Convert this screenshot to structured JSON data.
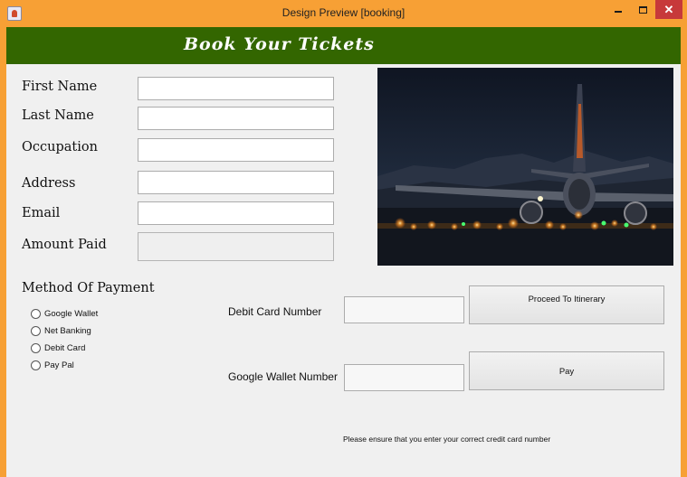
{
  "window": {
    "title": "Design Preview [booking]",
    "close_glyph": "✕"
  },
  "banner": {
    "title": "Book Your Tickets"
  },
  "form": {
    "first_name_label": "First Name",
    "last_name_label": "Last Name",
    "occupation_label": "Occupation",
    "address_label": "Address",
    "email_label": "Email",
    "amount_paid_label": "Amount Paid",
    "first_name_value": "",
    "last_name_value": "",
    "occupation_value": "",
    "address_value": "",
    "email_value": "",
    "amount_paid_value": ""
  },
  "photo": {
    "subject": "airplane on runway at night"
  },
  "payment": {
    "heading": "Method Of Payment",
    "options": [
      "Google Wallet",
      "Net Banking",
      "Debit Card",
      "Pay Pal"
    ],
    "debit_card_label": "Debit Card Number",
    "google_wallet_label": "Google Wallet Number",
    "debit_card_value": "",
    "google_wallet_value": ""
  },
  "actions": {
    "proceed_label": "Proceed To Itinerary",
    "pay_label": "Pay"
  },
  "notice": "Please ensure that you enter your correct credit card number",
  "colors": {
    "frame": "#f7a035",
    "banner": "#336600",
    "close_button": "#c7393a",
    "panel": "#f0f0f0"
  }
}
